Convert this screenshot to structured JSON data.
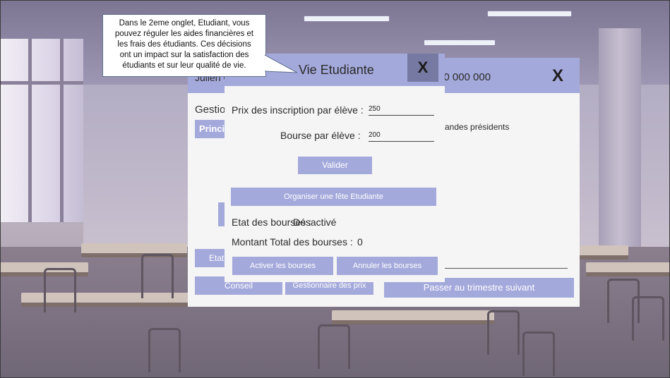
{
  "main_window": {
    "player_name": "Julien C",
    "budget": "50 000 000",
    "close_label": "X",
    "section_label": "Gestion",
    "tab_principal": "Princip",
    "demandes_text": "mandes présidents",
    "etat_button": "Etat d",
    "conseil_button": "Conseil",
    "gestionnaire_button": "Gestionnaire des prix",
    "next_quarter_button": "Passer au trimestre suivant"
  },
  "dialog": {
    "title": "Vie Etudiante",
    "close_label": "X",
    "tuition_label": "Prix des inscription par élève :",
    "tuition_value": "250",
    "grant_label": "Bourse par élève :",
    "grant_value": "200",
    "validate_button": "Valider",
    "party_button": "Organiser une fête Etudiante",
    "grants_state_label": "Etat des bourses :",
    "grants_state_value": "Désactivé",
    "grants_total_label": "Montant Total des bourses :",
    "grants_total_value": "0",
    "activate_button": "Activer les bourses",
    "cancel_button": "Annuler les bourses"
  },
  "tooltip": {
    "lines": [
      "Dans le 2eme onglet, Etudiant, vous",
      "pouvez réguler les aides financières et",
      "les frais des étudiants. Ces décisions",
      "ont un impact sur la satisfaction des",
      "étudiants et sur leur qualité de vie."
    ]
  },
  "colors": {
    "accent": "#a4a9db",
    "close_dark": "#767aa3",
    "panel": "#f5f5f5"
  }
}
